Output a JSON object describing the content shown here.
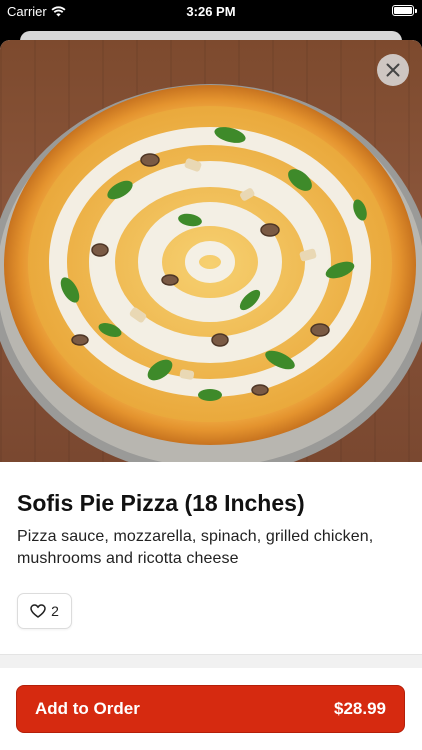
{
  "status_bar": {
    "carrier": "Carrier",
    "time": "3:26 PM",
    "icons": [
      "wifi-icon",
      "battery-icon"
    ]
  },
  "item": {
    "title": "Sofis Pie Pizza (18 Inches)",
    "description": "Pizza sauce, mozzarella, spinach, grilled chicken, mushrooms and ricotta cheese",
    "image": "pizza-photo"
  },
  "actions": {
    "close_icon": "close-icon",
    "like_icon": "heart-icon",
    "like_count": "2",
    "add_label": "Add to Order",
    "price": "$28.99"
  },
  "colors": {
    "accent": "#d62a10",
    "background": "#ffffff"
  }
}
